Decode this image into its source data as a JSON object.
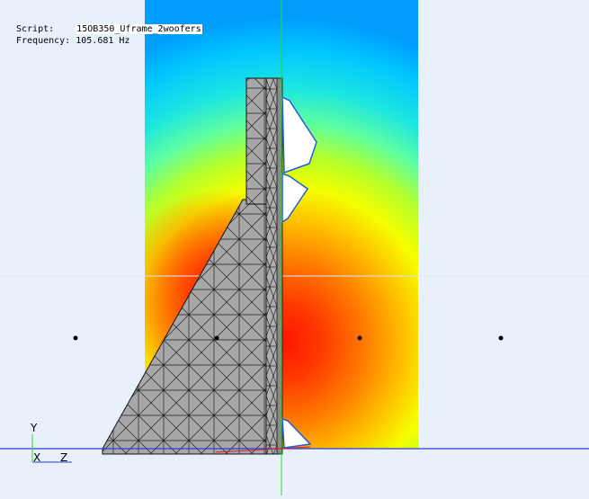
{
  "info": {
    "script_label": "Script:",
    "script_value": "15OB350_Uframe_2woofers",
    "frequency_label": "Frequency:",
    "frequency_value": "105.681 Hz"
  },
  "axes": {
    "y_label": "Y",
    "x_label": "X",
    "z_label": "Z"
  },
  "colors": {
    "background": "#e8f1fb",
    "mesh_fill": "#a9a9a9",
    "mesh_edge": "#1a1a1a",
    "x_axis": "#2a3bd6",
    "y_axis": "#2fd62f",
    "field_hot": "#ff1a00",
    "field_cold": "#00b7ff"
  }
}
